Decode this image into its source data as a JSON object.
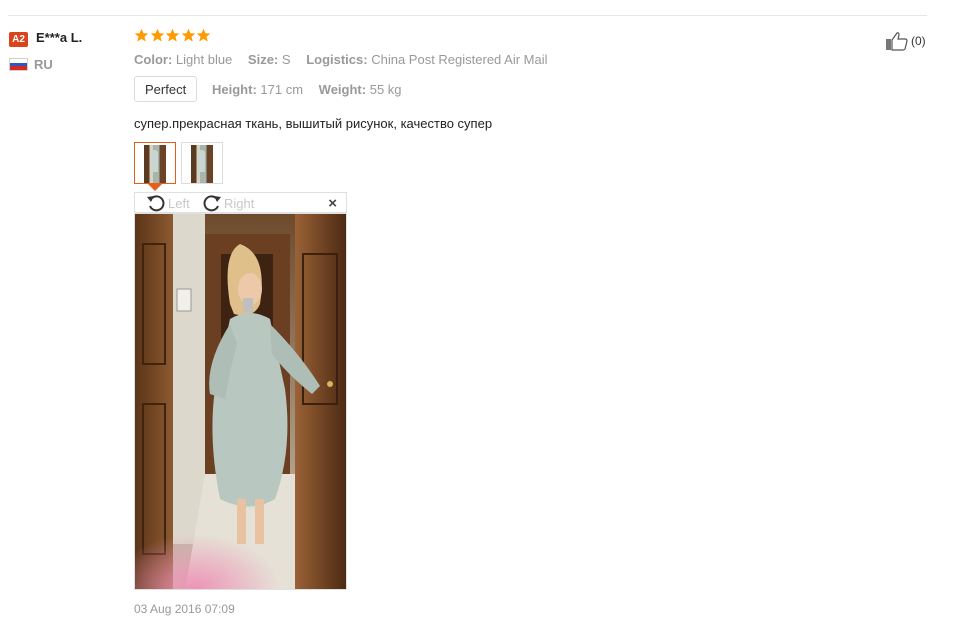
{
  "reviewer": {
    "badge": "A2",
    "name": "E***a L.",
    "country": "RU",
    "flag_colors": [
      "#ffffff",
      "#2f56c2",
      "#d52b1e"
    ]
  },
  "rating": {
    "stars": 5,
    "max": 5,
    "color": "#ff9a00"
  },
  "attributes": [
    {
      "key": "Color:",
      "value": "Light blue"
    },
    {
      "key": "Size:",
      "value": "S"
    },
    {
      "key": "Logistics:",
      "value": "China Post Registered Air Mail"
    }
  ],
  "fit_tag": "Perfect",
  "measurements": [
    {
      "key": "Height:",
      "value": "171 cm"
    },
    {
      "key": "Weight:",
      "value": "55 kg"
    }
  ],
  "review_text": "супер.прекрасная ткань, вышитый рисунок, качество супер",
  "thumbnails": [
    {
      "name": "photo-1",
      "selected": true
    },
    {
      "name": "photo-2",
      "selected": false
    }
  ],
  "viewer": {
    "rotate_left_label": "Left",
    "rotate_right_label": "Right",
    "close_symbol": "×"
  },
  "date": "03 Aug 2016 07:09",
  "helpful": {
    "count_label": "(0)",
    "icon": "thumbs-up-icon"
  },
  "accent_color": "#e45e1c"
}
